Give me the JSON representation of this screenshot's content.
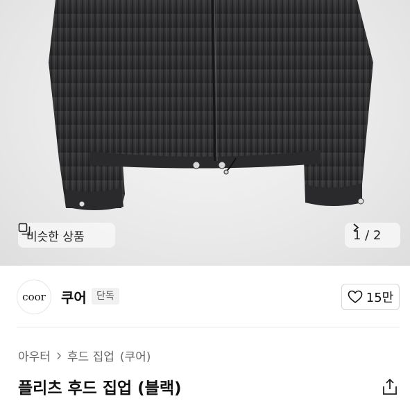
{
  "hero": {
    "similar_label": "비슷한 상품",
    "pager": "1 / 2",
    "icons": {
      "similar": "similar-items-icon",
      "next": "chevron-right-icon"
    }
  },
  "brand": {
    "logo_text": "coor",
    "name": "쿠어",
    "badge": "단독",
    "likes": "15만"
  },
  "breadcrumb": [
    "아우터",
    "후드 집업",
    "(쿠어)"
  ],
  "product": {
    "title": "플리츠 후드 집업 (블랙)"
  },
  "colors": {
    "jacket": "#2b2b2d",
    "background": "#ececec"
  }
}
